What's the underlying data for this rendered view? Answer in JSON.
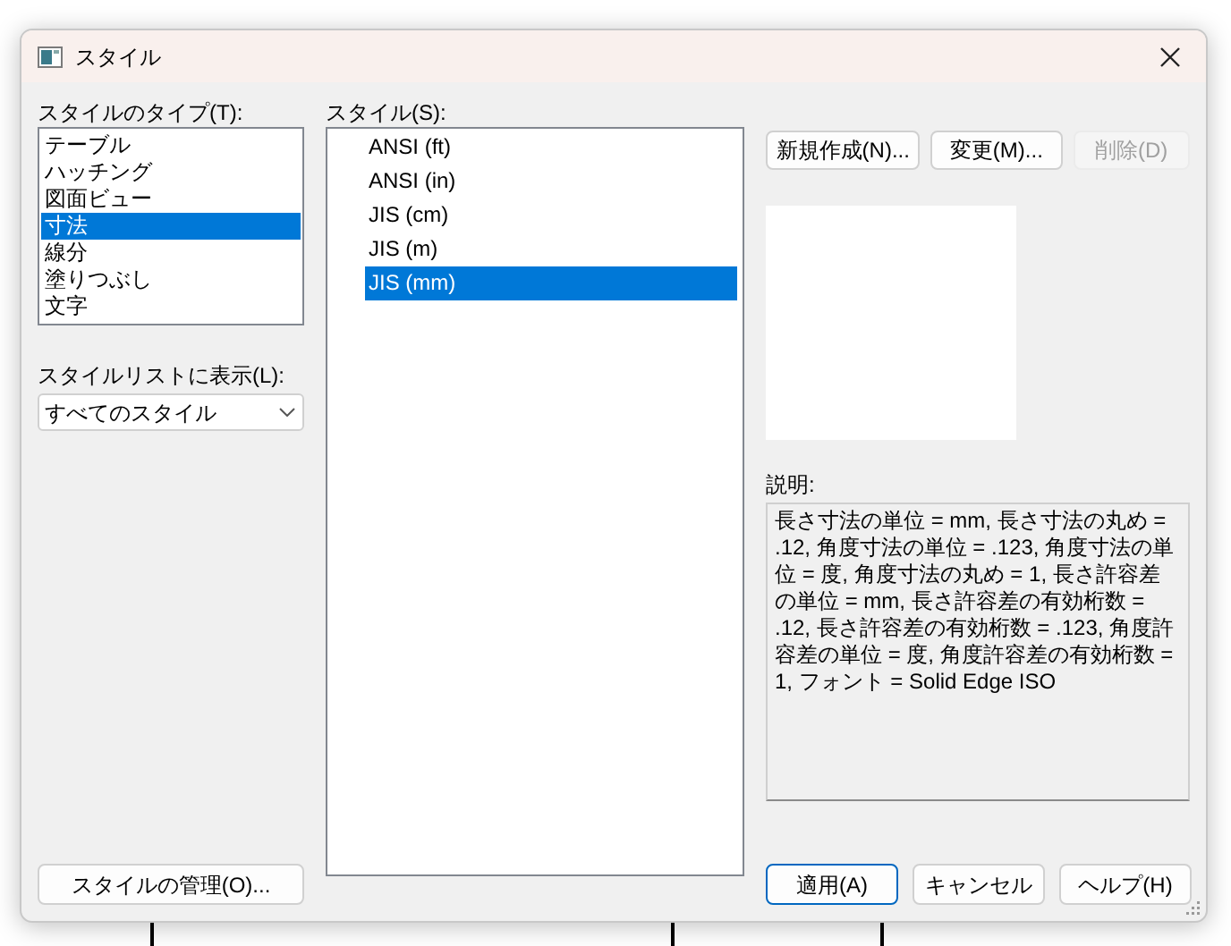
{
  "window": {
    "title": "スタイル"
  },
  "style_types": {
    "label": "スタイルのタイプ(T):",
    "items": [
      {
        "label": "テーブル",
        "selected": false
      },
      {
        "label": "ハッチング",
        "selected": false
      },
      {
        "label": "図面ビュー",
        "selected": false
      },
      {
        "label": "寸法",
        "selected": true
      },
      {
        "label": "線分",
        "selected": false
      },
      {
        "label": "塗りつぶし",
        "selected": false
      },
      {
        "label": "文字",
        "selected": false
      }
    ]
  },
  "list_filter": {
    "label": "スタイルリストに表示(L):",
    "value": "すべてのスタイル"
  },
  "manage_button": {
    "label": "スタイルの管理(O)..."
  },
  "styles": {
    "label": "スタイル(S):",
    "items": [
      {
        "label": "ANSI (ft)",
        "selected": false
      },
      {
        "label": "ANSI (in)",
        "selected": false
      },
      {
        "label": "JIS (cm)",
        "selected": false
      },
      {
        "label": "JIS (m)",
        "selected": false
      },
      {
        "label": "JIS (mm)",
        "selected": true
      }
    ]
  },
  "style_buttons": [
    {
      "label": "新規作成(N)...",
      "disabled": false
    },
    {
      "label": "変更(M)...",
      "disabled": false
    },
    {
      "label": "削除(D)",
      "disabled": true
    }
  ],
  "description": {
    "label": "説明:",
    "text": "長さ寸法の単位 = mm, 長さ寸法の丸め = .12, 角度寸法の単位 = .123, 角度寸法の単位 = 度, 角度寸法の丸め = 1, 長さ許容差の単位 = mm, 長さ許容差の有効桁数 = .12, 長さ許容差の有効桁数 = .123, 角度許容差の単位 = 度, 角度許容差の有効桁数 = 1, フォント = Solid Edge ISO"
  },
  "dialog_buttons": [
    {
      "label": "適用(A)",
      "focused": true
    },
    {
      "label": "キャンセル",
      "focused": false
    },
    {
      "label": "ヘルプ(H)",
      "focused": false
    }
  ]
}
